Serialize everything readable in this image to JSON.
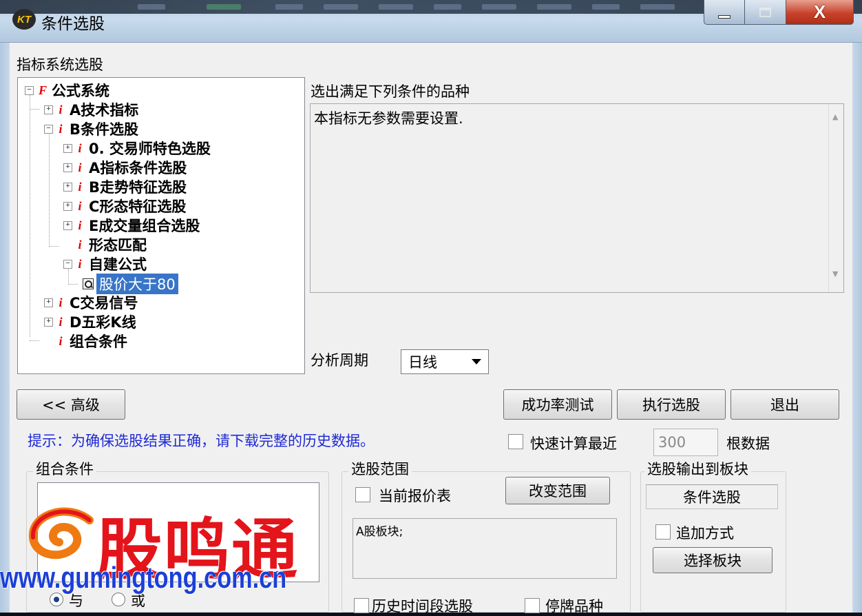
{
  "window": {
    "title": "条件选股",
    "icon_text": "KT",
    "buttons": [
      "minimize",
      "maximize",
      "close"
    ],
    "close_glyph": "X"
  },
  "section_label": "指标系统选股",
  "tree": {
    "root": "公式系统",
    "items": [
      {
        "label": "A技术指标",
        "level": 1
      },
      {
        "label": "B条件选股",
        "level": 1
      },
      {
        "label": "0. 交易师特色选股",
        "level": 2
      },
      {
        "label": "A指标条件选股",
        "level": 2
      },
      {
        "label": "B走势特征选股",
        "level": 2
      },
      {
        "label": "C形态特征选股",
        "level": 2
      },
      {
        "label": "E成交量组合选股",
        "level": 2
      },
      {
        "label": "形态匹配",
        "level": 2
      },
      {
        "label": "自建公式",
        "level": 2
      },
      {
        "label": "股价大于80",
        "level": 3,
        "selected": true
      },
      {
        "label": "C交易信号",
        "level": 1
      },
      {
        "label": "D五彩K线",
        "level": 1
      },
      {
        "label": "组合条件",
        "level": 1
      }
    ]
  },
  "conditions": {
    "label": "选出满足下列条件的品种",
    "description": "本指标无参数需要设置."
  },
  "period": {
    "label": "分析周期",
    "value": "日线"
  },
  "buttons": {
    "advanced": "<< 高级",
    "success_test": "成功率测试",
    "execute": "执行选股",
    "exit": "退出",
    "change_range": "改变范围",
    "choose_block": "选择板块"
  },
  "hint": "提示：为确保选股结果正确，请下载完整的历史数据。",
  "fast_calc": {
    "label": "快速计算最近",
    "value": "300",
    "suffix": "根数据",
    "checked": false
  },
  "combo_group": {
    "title": "组合条件",
    "radio_and": "与",
    "radio_or": "或",
    "selected": "与"
  },
  "range_group": {
    "title": "选股范围",
    "current_quote_label": "当前报价表",
    "current_quote_checked": false,
    "range_text": "A股板块;",
    "history_label": "历史时间段选股",
    "suspended_label": "停牌品种"
  },
  "output_group": {
    "title": "选股输出到板块",
    "target": "条件选股",
    "append_label": "追加方式",
    "append_checked": false
  },
  "watermark": {
    "brand": "股鸣通",
    "url": "www.gumingtong.com.cn"
  },
  "colors": {
    "hint": "#1f2ad6",
    "tree_icon": "#e00000",
    "selection": "#3875c8",
    "watermark_red": "#e3141a",
    "watermark_blue": "#1b3fd8"
  }
}
